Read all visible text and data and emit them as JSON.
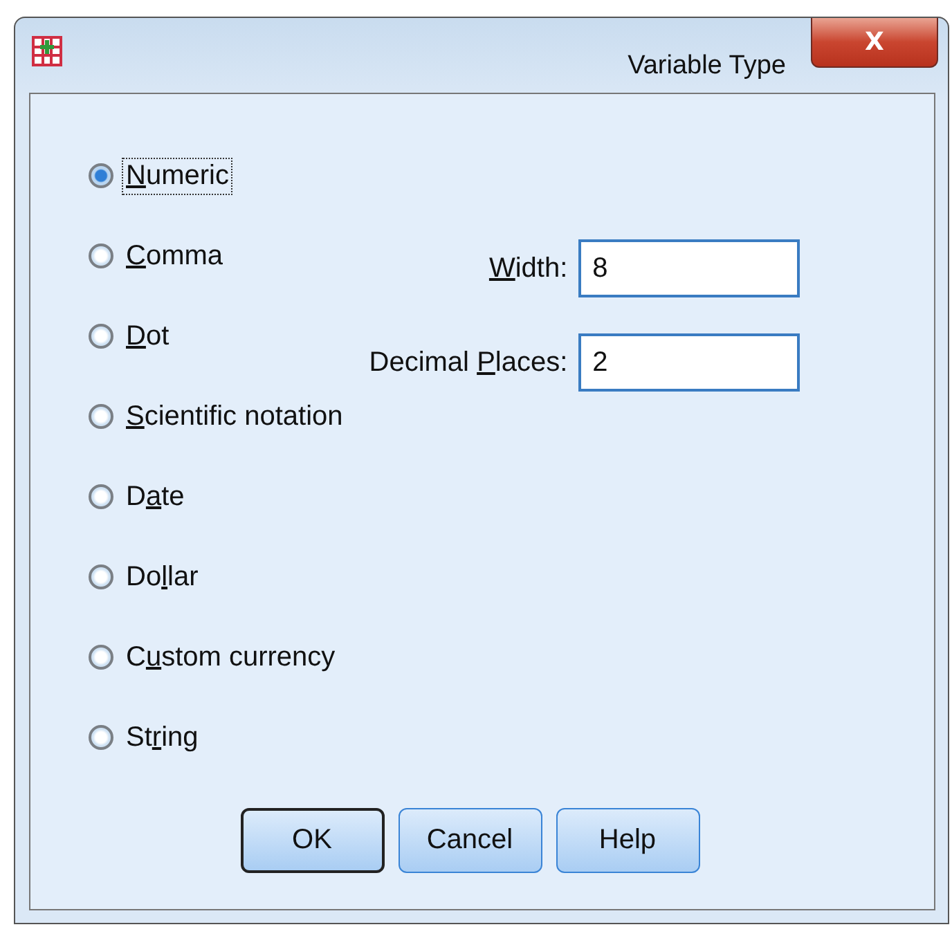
{
  "window": {
    "title": "Variable Type",
    "close_symbol": "X"
  },
  "types": [
    {
      "key": "N",
      "after": "umeric",
      "selected": true,
      "focused": true
    },
    {
      "key": "C",
      "after": "omma",
      "selected": false,
      "focused": false
    },
    {
      "key": "D",
      "after": "ot",
      "selected": false,
      "focused": false
    },
    {
      "key": "S",
      "after": "cientific notation",
      "selected": false,
      "focused": false
    },
    {
      "before": "D",
      "key": "a",
      "after": "te",
      "selected": false,
      "focused": false
    },
    {
      "before": "Do",
      "key": "l",
      "after": "lar",
      "selected": false,
      "focused": false
    },
    {
      "before": "C",
      "key": "u",
      "after": "stom currency",
      "selected": false,
      "focused": false
    },
    {
      "before": "St",
      "key": "r",
      "after": "ing",
      "selected": false,
      "focused": false
    }
  ],
  "fields": [
    {
      "key": "W",
      "after": "idth:",
      "value": "8"
    },
    {
      "before": "Decimal ",
      "key": "P",
      "after": "laces:",
      "value": "2"
    }
  ],
  "buttons": [
    {
      "label": "OK",
      "default": true
    },
    {
      "label": "Cancel",
      "default": false
    },
    {
      "label": "Help",
      "default": false
    }
  ]
}
